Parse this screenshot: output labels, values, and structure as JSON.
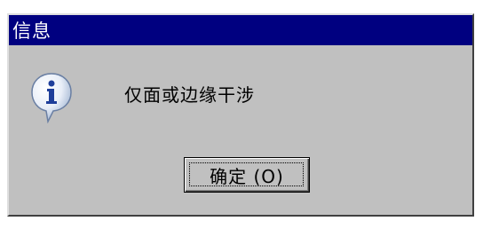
{
  "dialog": {
    "title": "信息",
    "message": "仅面或边缘干涉",
    "icon": "info-icon",
    "ok_button_label": "确定 (O)"
  },
  "colors": {
    "titlebar": "#000080",
    "face": "#c0c0c0",
    "title_text": "#ffffff"
  }
}
